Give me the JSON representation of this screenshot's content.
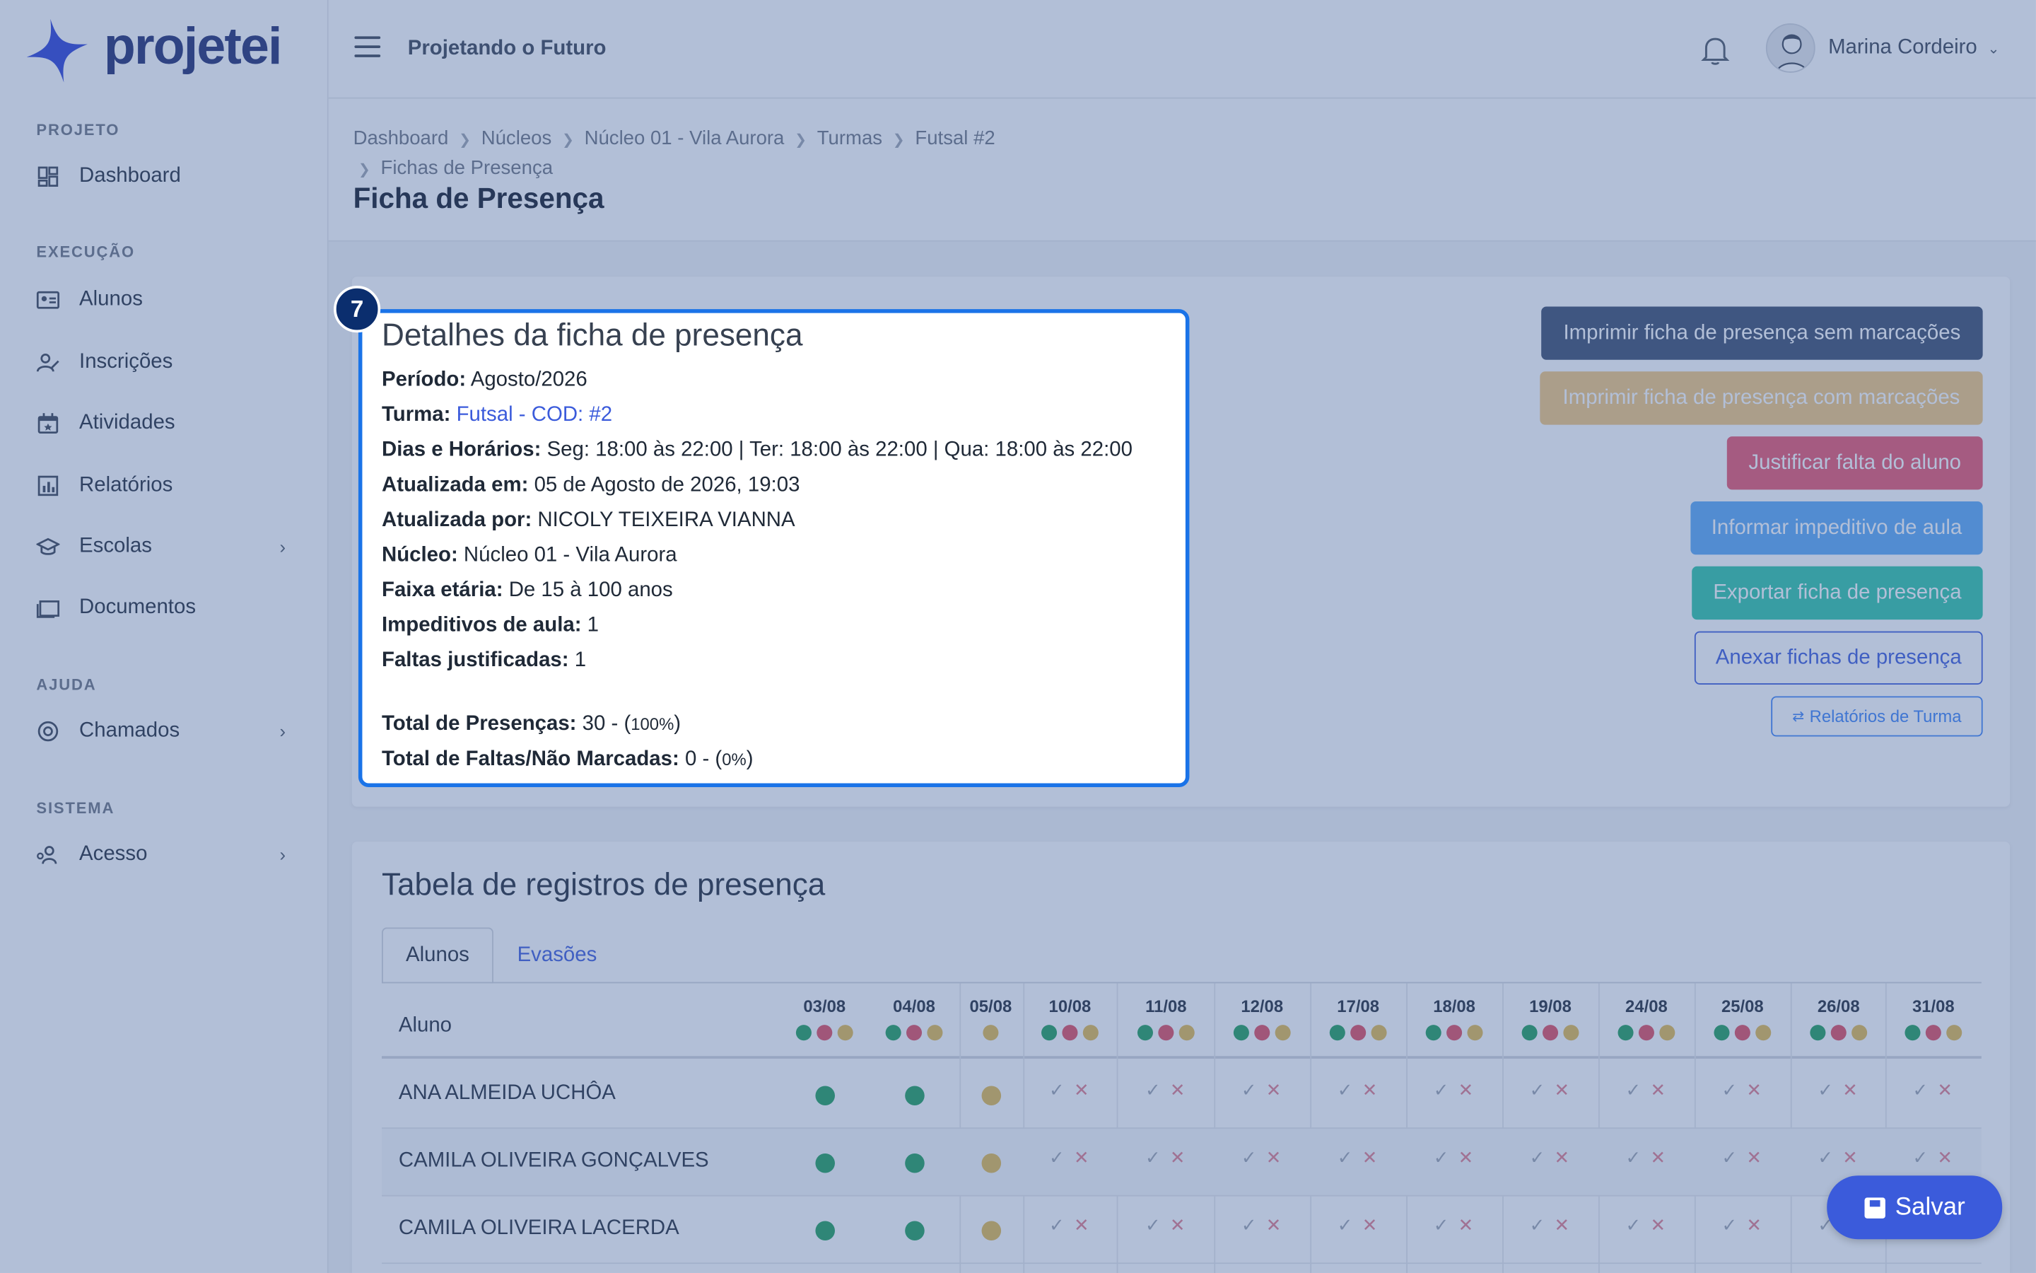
{
  "app": {
    "logo_text": "projetei",
    "project_name": "Projetando o Futuro"
  },
  "user": {
    "name": "Marina Cordeiro"
  },
  "sidebar": {
    "sections": [
      "PROJETO",
      "EXECUÇÃO",
      "AJUDA",
      "SISTEMA"
    ],
    "items": [
      {
        "label": "Dashboard",
        "icon": "dashboard-icon"
      },
      {
        "label": "Alunos",
        "icon": "id-card-icon"
      },
      {
        "label": "Inscrições",
        "icon": "user-edit-icon"
      },
      {
        "label": "Atividades",
        "icon": "calendar-icon"
      },
      {
        "label": "Relatórios",
        "icon": "chart-icon"
      },
      {
        "label": "Escolas",
        "icon": "school-icon"
      },
      {
        "label": "Documentos",
        "icon": "folder-icon"
      },
      {
        "label": "Chamados",
        "icon": "lifebuoy-icon"
      },
      {
        "label": "Acesso",
        "icon": "users-key-icon"
      }
    ]
  },
  "breadcrumb": [
    "Dashboard",
    "Núcleos",
    "Núcleo 01 - Vila Aurora",
    "Turmas",
    "Futsal #2",
    "Fichas de Presença"
  ],
  "page_title": "Ficha de Presença",
  "step_badge": "7",
  "details": {
    "heading": "Detalhes da ficha de presença",
    "periodo_label": "Período:",
    "periodo": "Agosto/2026",
    "turma_label": "Turma:",
    "turma": "Futsal - COD: #2",
    "dias_label": "Dias e Horários:",
    "dias": "Seg: 18:00 às 22:00 | Ter: 18:00 às 22:00 | Qua: 18:00 às 22:00",
    "atualizada_em_label": "Atualizada em:",
    "atualizada_em": "05 de Agosto de 2026, 19:03",
    "atualizada_por_label": "Atualizada por:",
    "atualizada_por": "NICOLY TEIXEIRA VIANNA",
    "nucleo_label": "Núcleo:",
    "nucleo": "Núcleo 01 - Vila Aurora",
    "faixa_label": "Faixa etária:",
    "faixa": "De 15 à 100 anos",
    "impeditivos_label": "Impeditivos de aula:",
    "impeditivos": "1",
    "faltas_just_label": "Faltas justificadas:",
    "faltas_just": "1",
    "total_pres_label": "Total de Presenças:",
    "total_pres": "30 - (",
    "total_pres_pct": "100%",
    "total_pres_close": ")",
    "total_faltas_label": "Total de Faltas/Não Marcadas:",
    "total_faltas": "0 - (",
    "total_faltas_pct": "0%",
    "total_faltas_close": ")"
  },
  "actions": {
    "print_blank": "Imprimir ficha de presença sem marcações",
    "print_marked": "Imprimir ficha de presença com marcações",
    "justify": "Justificar falta do aluno",
    "impediment": "Informar impeditivo de aula",
    "export": "Exportar ficha de presença",
    "attach": "Anexar fichas de presença",
    "reports": "Relatórios de Turma"
  },
  "table": {
    "title": "Tabela de registros de presença",
    "tabs": [
      "Alunos",
      "Evasões"
    ],
    "student_header": "Aluno",
    "dates": [
      "03/08",
      "04/08",
      "05/08",
      "10/08",
      "11/08",
      "12/08",
      "17/08",
      "18/08",
      "19/08",
      "24/08",
      "25/08",
      "26/08",
      "31/08"
    ],
    "rows": [
      {
        "name": "ANA ALMEIDA UCHÔA",
        "marks": [
          "present",
          "present",
          "justified"
        ]
      },
      {
        "name": "CAMILA OLIVEIRA GONÇALVES",
        "marks": [
          "present",
          "present",
          "justified"
        ]
      },
      {
        "name": "CAMILA OLIVEIRA LACERDA",
        "marks": [
          "present",
          "present",
          "justified"
        ]
      }
    ],
    "colors": {
      "present": "#1e9e5a",
      "absent": "#e04a5e",
      "justified": "#e2b84d"
    }
  },
  "save_label": "Salvar"
}
